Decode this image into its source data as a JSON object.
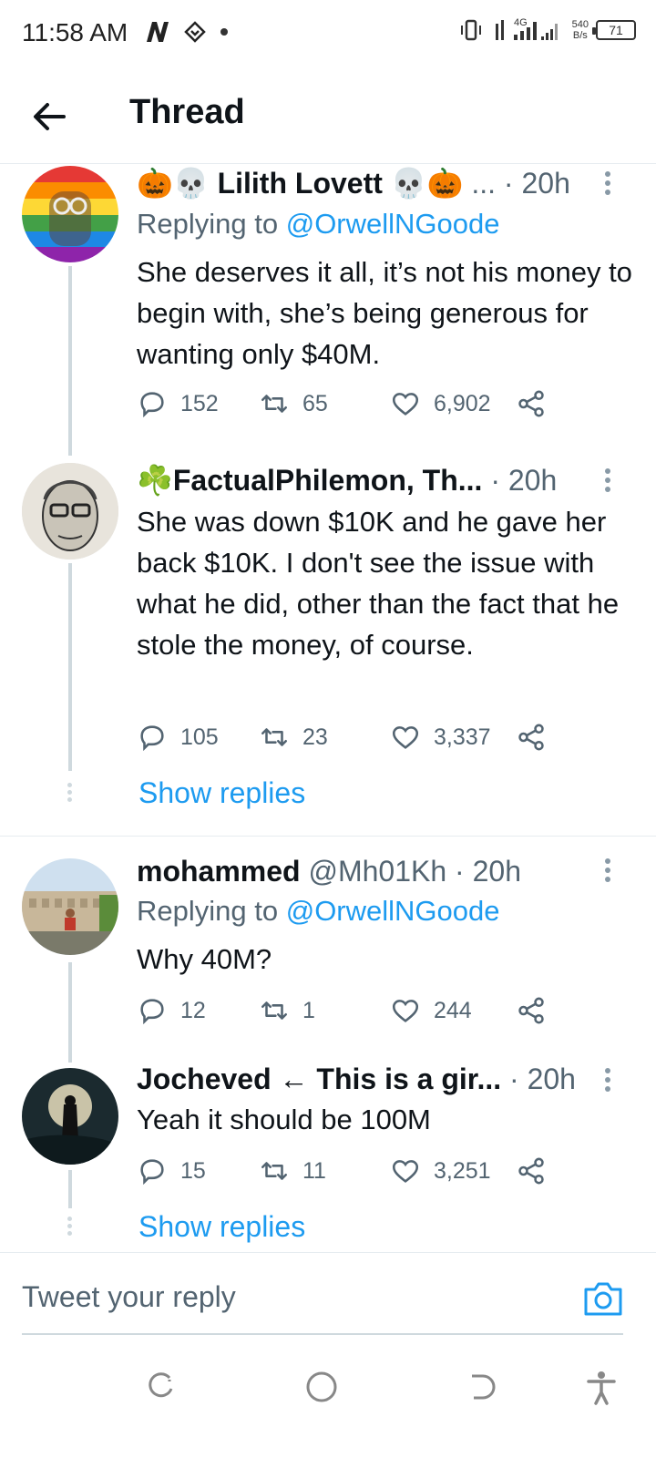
{
  "status_bar": {
    "time": "11:58 AM",
    "network_speed_value": "540",
    "network_speed_unit": "B/s",
    "battery": "71",
    "signal_label": "4G"
  },
  "header": {
    "title": "Thread"
  },
  "tweets": [
    {
      "name": "Lilith Lovett",
      "name_prefix_emoji": "🎃💀",
      "name_suffix_emoji": "💀🎃",
      "ellipsis": "...",
      "time": "· 20h",
      "replying_label": "Replying to",
      "replying_to": "@OrwellNGoode",
      "text": "She deserves it all, it’s not his money to begin with, she’s being generous for wanting only $40M.",
      "replies": "152",
      "retweets": "65",
      "likes": "6,902"
    },
    {
      "name_prefix_emoji": "☘️",
      "name": "FactualPhilemon, Th...",
      "time": "· 20h",
      "text": "She was down $10K and he gave her back $10K. I don't see the issue with what he did, other than the fact that he stole the money, of course.",
      "replies": "105",
      "retweets": "23",
      "likes": "3,337",
      "show_replies": "Show replies"
    },
    {
      "name": "mohammed",
      "handle": "@Mh01Kh",
      "time": "· 20h",
      "replying_label": "Replying to",
      "replying_to": "@OrwellNGoode",
      "text": "Why 40M?",
      "replies": "12",
      "retweets": "1",
      "likes": "244"
    },
    {
      "name": "Jocheved ← This is a gir...",
      "time": "· 20h",
      "text": "Yeah it should be 100M",
      "replies": "15",
      "retweets": "11",
      "likes": "3,251",
      "show_replies": "Show replies"
    }
  ],
  "reply_bar": {
    "placeholder": "Tweet your reply"
  },
  "colors": {
    "accent": "#1d9bf0",
    "secondary_text": "#536471",
    "divider": "#e6ecf0"
  },
  "icons": [
    "back-arrow-icon",
    "reply-icon",
    "retweet-icon",
    "like-icon",
    "share-icon",
    "more-icon",
    "camera-icon",
    "recent-apps-icon",
    "home-icon",
    "back-icon",
    "accessibility-icon"
  ]
}
